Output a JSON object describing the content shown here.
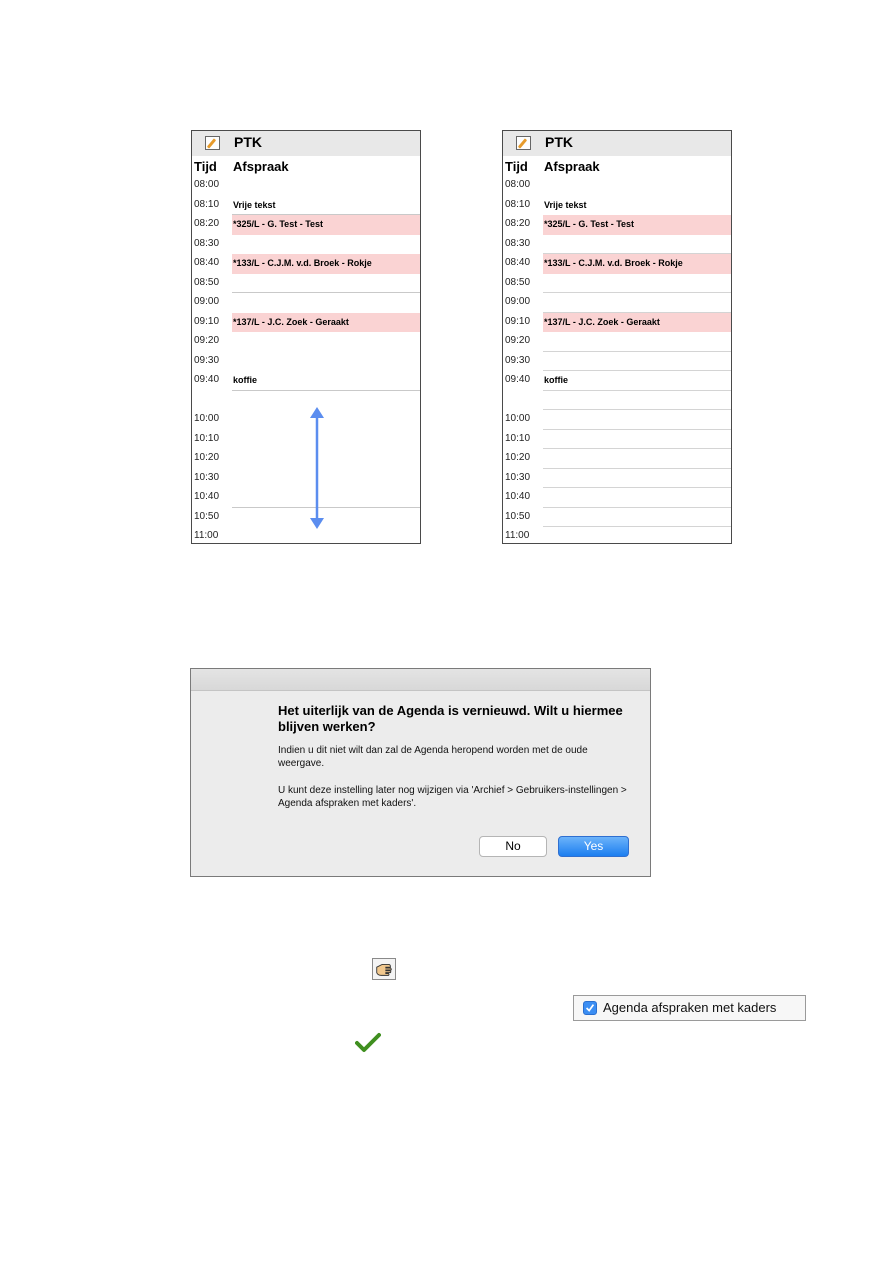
{
  "agenda_left": {
    "title": "PTK",
    "col_time": "Tijd",
    "col_appointment": "Afspraak",
    "rows": [
      {
        "time": "08:00",
        "text": "",
        "type": "plain"
      },
      {
        "time": "08:10",
        "text": "Vrije tekst",
        "type": "plain"
      },
      {
        "time": "08:20",
        "text": "*325/L - G. Test - Test",
        "type": "appt"
      },
      {
        "time": "08:30",
        "text": "",
        "type": "plain"
      },
      {
        "time": "08:40",
        "text": "*133/L - C.J.M. v.d. Broek - Rokje",
        "type": "appt"
      },
      {
        "time": "08:50",
        "text": "",
        "type": "plain"
      },
      {
        "time": "09:00",
        "text": "",
        "type": "plain"
      },
      {
        "time": "09:10",
        "text": "*137/L - J.C. Zoek - Geraakt",
        "type": "appt"
      },
      {
        "time": "09:20",
        "text": "",
        "type": "plain"
      },
      {
        "time": "09:30",
        "text": "",
        "type": "plain"
      },
      {
        "time": "09:40",
        "text": "koffie",
        "type": "plain"
      },
      {
        "time": "",
        "text": "",
        "type": "plain"
      },
      {
        "time": "10:00",
        "text": "",
        "type": "plain"
      },
      {
        "time": "10:10",
        "text": "",
        "type": "plain"
      },
      {
        "time": "10:20",
        "text": "",
        "type": "plain"
      },
      {
        "time": "10:30",
        "text": "",
        "type": "plain"
      },
      {
        "time": "10:40",
        "text": "",
        "type": "plain"
      },
      {
        "time": "10:50",
        "text": "",
        "type": "plain"
      },
      {
        "time": "11:00",
        "text": "",
        "type": "plain"
      }
    ]
  },
  "agenda_right": {
    "title": "PTK",
    "col_time": "Tijd",
    "col_appointment": "Afspraak",
    "rows": [
      {
        "time": "08:00",
        "text": "",
        "type": "plain"
      },
      {
        "time": "08:10",
        "text": "Vrije tekst",
        "type": "plain"
      },
      {
        "time": "08:20",
        "text": "*325/L - G. Test - Test",
        "type": "appt"
      },
      {
        "time": "08:30",
        "text": "",
        "type": "plain"
      },
      {
        "time": "08:40",
        "text": "*133/L - C.J.M. v.d. Broek - Rokje",
        "type": "appt"
      },
      {
        "time": "08:50",
        "text": "",
        "type": "plain"
      },
      {
        "time": "09:00",
        "text": "",
        "type": "plain"
      },
      {
        "time": "09:10",
        "text": "*137/L - J.C. Zoek - Geraakt",
        "type": "appt"
      },
      {
        "time": "09:20",
        "text": "",
        "type": "plain"
      },
      {
        "time": "09:30",
        "text": "",
        "type": "plain"
      },
      {
        "time": "09:40",
        "text": "koffie",
        "type": "plain"
      },
      {
        "time": "",
        "text": "",
        "type": "plain"
      },
      {
        "time": "10:00",
        "text": "",
        "type": "plain"
      },
      {
        "time": "10:10",
        "text": "",
        "type": "plain"
      },
      {
        "time": "10:20",
        "text": "",
        "type": "plain"
      },
      {
        "time": "10:30",
        "text": "",
        "type": "plain"
      },
      {
        "time": "10:40",
        "text": "",
        "type": "plain"
      },
      {
        "time": "10:50",
        "text": "",
        "type": "plain"
      },
      {
        "time": "11:00",
        "text": "",
        "type": "plain"
      }
    ]
  },
  "colors": {
    "appointment_bg": "#fad3d3",
    "arrow": "#5b8def",
    "yes_button": "#1c7ef0",
    "checkmark": "#3f8f1f"
  },
  "dialog": {
    "title": "Het uiterlijk van de Agenda is vernieuwd. Wilt u hiermee blijven werken?",
    "message1": "Indien u dit niet wilt dan zal de Agenda heropend worden met de oude weergave.",
    "message2": "U kunt deze instelling later nog wijzigen via 'Archief > Gebruikers-instellingen > Agenda afspraken met kaders'.",
    "no_label": "No",
    "yes_label": "Yes"
  },
  "settings": {
    "checkbox_label": "Agenda afspraken met kaders",
    "checked": true
  },
  "icons": {
    "edit": "edit-icon",
    "hand": "hand-pointer-icon",
    "check": "green-checkmark-icon",
    "arrow": "double-arrow-icon"
  }
}
